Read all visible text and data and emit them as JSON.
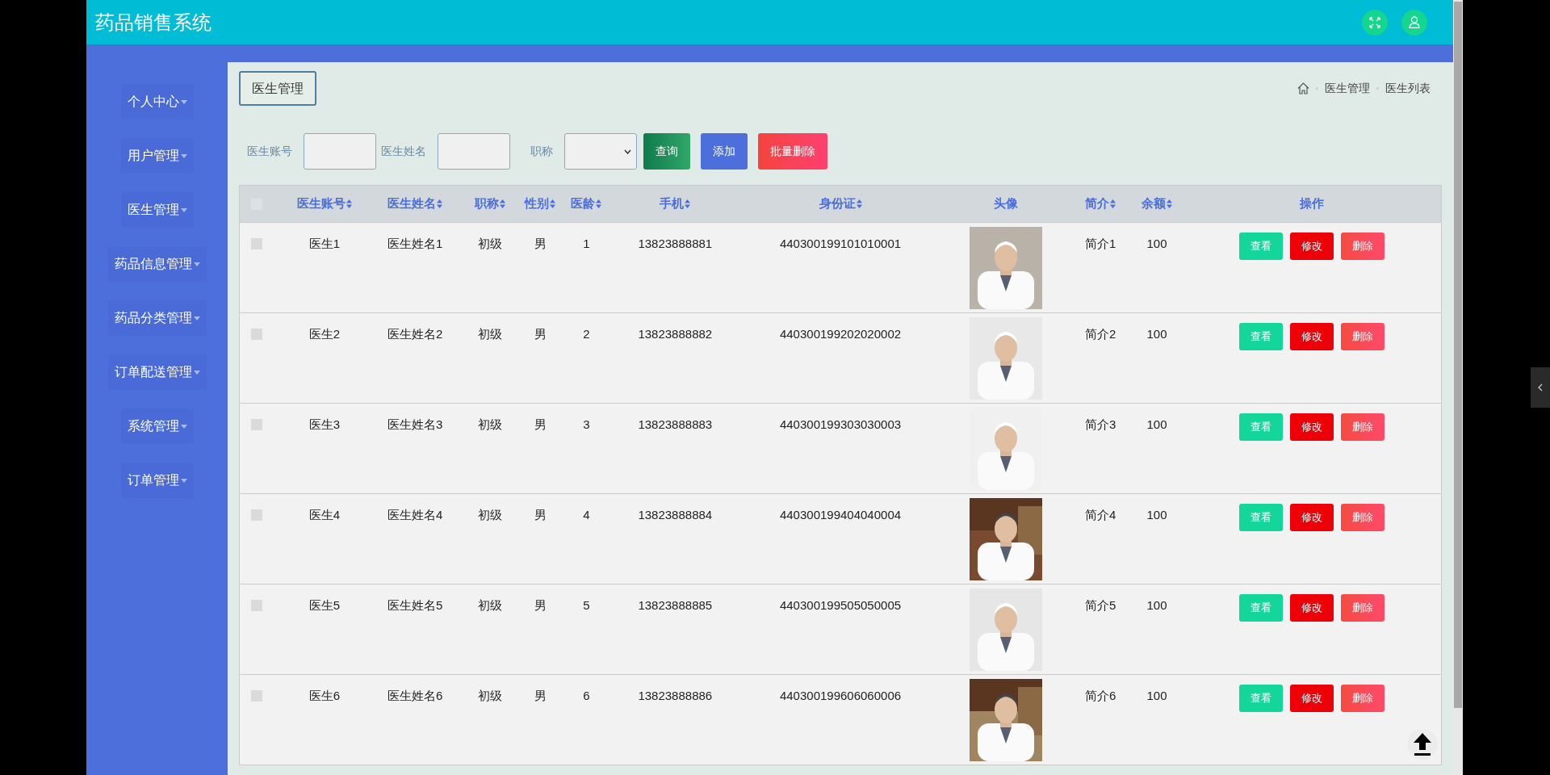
{
  "header": {
    "title": "药品销售系统"
  },
  "sidebar": {
    "items": [
      {
        "label": "个人中心"
      },
      {
        "label": "用户管理"
      },
      {
        "label": "医生管理"
      },
      {
        "label": "药品信息管理"
      },
      {
        "label": "药品分类管理"
      },
      {
        "label": "订单配送管理"
      },
      {
        "label": "系统管理"
      },
      {
        "label": "订单管理"
      }
    ]
  },
  "page_title": "医生管理",
  "breadcrumb": [
    "医生管理",
    "医生列表"
  ],
  "search": {
    "fields": [
      {
        "label": "医生账号",
        "kind": "input"
      },
      {
        "label": "医生姓名",
        "kind": "input"
      },
      {
        "label": "职称",
        "kind": "select"
      }
    ],
    "buttons": [
      {
        "label": "查询",
        "kind": "query"
      },
      {
        "label": "添加",
        "kind": "add"
      },
      {
        "label": "批量删除",
        "kind": "delete"
      }
    ]
  },
  "table": {
    "select_all": {
      "checked": false
    },
    "columns": [
      {
        "label": "医生账号",
        "sortable": true
      },
      {
        "label": "医生姓名",
        "sortable": true
      },
      {
        "label": "职称",
        "sortable": true
      },
      {
        "label": "性别",
        "sortable": true
      },
      {
        "label": "医龄",
        "sortable": true
      },
      {
        "label": "手机",
        "sortable": true
      },
      {
        "label": "身份证",
        "sortable": true
      },
      {
        "label": "头像",
        "sortable": false
      },
      {
        "label": "简介",
        "sortable": true
      },
      {
        "label": "余额",
        "sortable": true
      },
      {
        "label": "操作",
        "sortable": false
      }
    ],
    "rows": [
      {
        "checked": false,
        "cells": [
          "医生1",
          "医生姓名1",
          "初级",
          "男",
          "1",
          "13823888881",
          "440300199101010001",
          {
            "kind": "picture"
          },
          "简介1",
          "100",
          {
            "actions": [
              {
                "label": "查看",
                "kind": "view"
              },
              {
                "label": "修改",
                "kind": "edit"
              },
              {
                "label": "删除",
                "kind": "delete"
              }
            ]
          }
        ]
      },
      {
        "checked": false,
        "cells": [
          "医生2",
          "医生姓名2",
          "初级",
          "男",
          "2",
          "13823888882",
          "440300199202020002",
          {
            "kind": "picture"
          },
          "简介2",
          "100",
          {
            "actions": [
              {
                "label": "查看",
                "kind": "view"
              },
              {
                "label": "修改",
                "kind": "edit"
              },
              {
                "label": "删除",
                "kind": "delete"
              }
            ]
          }
        ]
      },
      {
        "checked": false,
        "cells": [
          "医生3",
          "医生姓名3",
          "初级",
          "男",
          "3",
          "13823888883",
          "440300199303030003",
          {
            "kind": "picture"
          },
          "简介3",
          "100",
          {
            "actions": [
              {
                "label": "查看",
                "kind": "view"
              },
              {
                "label": "修改",
                "kind": "edit"
              },
              {
                "label": "删除",
                "kind": "delete"
              }
            ]
          }
        ]
      },
      {
        "checked": false,
        "cells": [
          "医生4",
          "医生姓名4",
          "初级",
          "男",
          "4",
          "13823888884",
          "440300199404040004",
          {
            "kind": "picture"
          },
          "简介4",
          "100",
          {
            "actions": [
              {
                "label": "查看",
                "kind": "view"
              },
              {
                "label": "修改",
                "kind": "edit"
              },
              {
                "label": "删除",
                "kind": "delete"
              }
            ]
          }
        ]
      },
      {
        "checked": false,
        "cells": [
          "医生5",
          "医生姓名5",
          "初级",
          "男",
          "5",
          "13823888885",
          "440300199505050005",
          {
            "kind": "picture"
          },
          "简介5",
          "100",
          {
            "actions": [
              {
                "label": "查看",
                "kind": "view"
              },
              {
                "label": "修改",
                "kind": "edit"
              },
              {
                "label": "删除",
                "kind": "delete"
              }
            ]
          }
        ]
      },
      {
        "checked": false,
        "cells": [
          "医生6",
          "医生姓名6",
          "初级",
          "男",
          "6",
          "13823888886",
          "440300199606060006",
          {
            "kind": "picture"
          },
          "简介6",
          "100",
          {
            "actions": [
              {
                "label": "查看",
                "kind": "view"
              },
              {
                "label": "修改",
                "kind": "edit"
              },
              {
                "label": "删除",
                "kind": "delete"
              }
            ]
          }
        ]
      }
    ]
  }
}
